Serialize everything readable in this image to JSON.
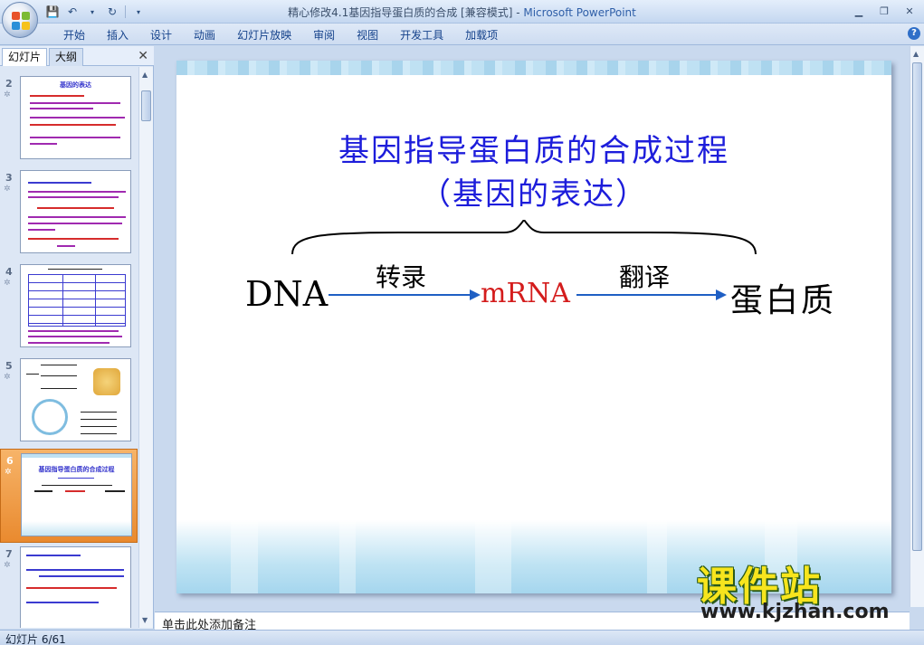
{
  "window": {
    "title": "精心修改4.1基因指导蛋白质的合成 [兼容模式]",
    "app_name": "Microsoft PowerPoint",
    "separator": " - "
  },
  "ribbon": {
    "tabs": [
      "开始",
      "插入",
      "设计",
      "动画",
      "幻灯片放映",
      "审阅",
      "视图",
      "开发工具",
      "加载项"
    ]
  },
  "left_pane": {
    "tab_slides": "幻灯片",
    "tab_outline": "大纲",
    "thumbnails": [
      {
        "number": "2",
        "title": "基因的表达",
        "selected": false
      },
      {
        "number": "3",
        "title": "",
        "selected": false
      },
      {
        "number": "4",
        "title": "",
        "selected": false
      },
      {
        "number": "5",
        "title": "",
        "selected": false
      },
      {
        "number": "6",
        "title": "基因指导蛋白质的合成过程",
        "selected": true
      },
      {
        "number": "7",
        "title": "",
        "selected": false
      }
    ]
  },
  "slide": {
    "title_line1": "基因指导蛋白质的合成过程",
    "title_line2": "（基因的表达）",
    "dna": "DNA",
    "mrna": "mRNA",
    "protein": "蛋白质",
    "transcription": "转录",
    "translation": "翻译",
    "colors": {
      "title": "#1d1ddb",
      "mrna": "#d41c1c",
      "arrow": "#1f5fc4",
      "text": "#000000"
    }
  },
  "notes": {
    "placeholder": "单击此处添加备注"
  },
  "status": {
    "slide_indicator": "幻灯片 6/61"
  },
  "watermark": {
    "brand": "课件站",
    "url": "www.kjzhan.com"
  }
}
